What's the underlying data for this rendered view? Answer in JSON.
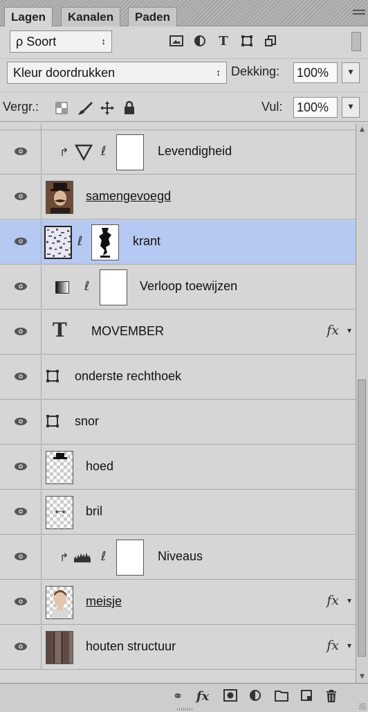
{
  "tabs": [
    {
      "label": "Lagen",
      "active": true
    },
    {
      "label": "Kanalen",
      "active": false
    },
    {
      "label": "Paden",
      "active": false
    }
  ],
  "filter": {
    "search_glyph": "ρ",
    "kind_label": "Soort",
    "stepper_glyph": "↕",
    "filter_icons": [
      "image-filter-icon",
      "adjustment-filter-icon",
      "type-filter-icon",
      "shape-filter-icon",
      "smart-object-filter-icon"
    ]
  },
  "blend": {
    "mode": "Kleur doordrukken",
    "opacity_label": "Dekking:",
    "opacity_value": "100%"
  },
  "lock": {
    "label": "Vergr.:",
    "fill_label": "Vul:",
    "fill_value": "100%",
    "icons": [
      "lock-transparent-pixels-icon",
      "lock-image-pixels-icon",
      "lock-position-icon",
      "lock-all-icon"
    ]
  },
  "layers": [
    {
      "name": "Levendigheid",
      "kind": "adjustment-vibrance",
      "clipped": true,
      "mask": true,
      "underline": false,
      "fx": false,
      "selected": false
    },
    {
      "name": "samengevoegd",
      "kind": "pixel-portrait",
      "clipped": false,
      "mask": false,
      "underline": true,
      "fx": false,
      "selected": false
    },
    {
      "name": "krant",
      "kind": "pixel-noise",
      "clipped": false,
      "mask": true,
      "underline": false,
      "fx": false,
      "selected": true
    },
    {
      "name": "Verloop toewijzen",
      "kind": "adjustment-gradient-map",
      "clipped": false,
      "mask": true,
      "underline": false,
      "fx": false,
      "selected": false
    },
    {
      "name": "MOVEMBER",
      "kind": "type",
      "clipped": false,
      "mask": false,
      "underline": false,
      "fx": true,
      "selected": false
    },
    {
      "name": "onderste rechthoek",
      "kind": "shape",
      "clipped": false,
      "mask": false,
      "underline": false,
      "fx": false,
      "selected": false
    },
    {
      "name": "snor",
      "kind": "shape",
      "clipped": false,
      "mask": false,
      "underline": false,
      "fx": false,
      "selected": false
    },
    {
      "name": "hoed",
      "kind": "pixel-hat",
      "clipped": false,
      "mask": false,
      "underline": false,
      "fx": false,
      "selected": false
    },
    {
      "name": "bril",
      "kind": "pixel-glasses",
      "clipped": false,
      "mask": false,
      "underline": false,
      "fx": false,
      "selected": false
    },
    {
      "name": "Niveaus",
      "kind": "adjustment-levels",
      "clipped": true,
      "mask": true,
      "underline": false,
      "fx": false,
      "selected": false
    },
    {
      "name": "meisje",
      "kind": "pixel-girl",
      "clipped": false,
      "mask": false,
      "underline": true,
      "fx": true,
      "selected": false
    },
    {
      "name": "houten structuur",
      "kind": "pixel-wood",
      "clipped": false,
      "mask": false,
      "underline": false,
      "fx": true,
      "selected": false
    }
  ],
  "fx_label": "fx",
  "footer_icons": [
    "link-layers-icon",
    "add-layer-style-icon",
    "add-mask-icon",
    "new-adjustment-layer-icon",
    "new-group-icon",
    "new-layer-icon",
    "delete-layer-icon"
  ],
  "colors": {
    "panel_bg": "#d6d6d6",
    "selected_row": "#b6c9f2",
    "tab_strip": "#a9a9a9"
  }
}
